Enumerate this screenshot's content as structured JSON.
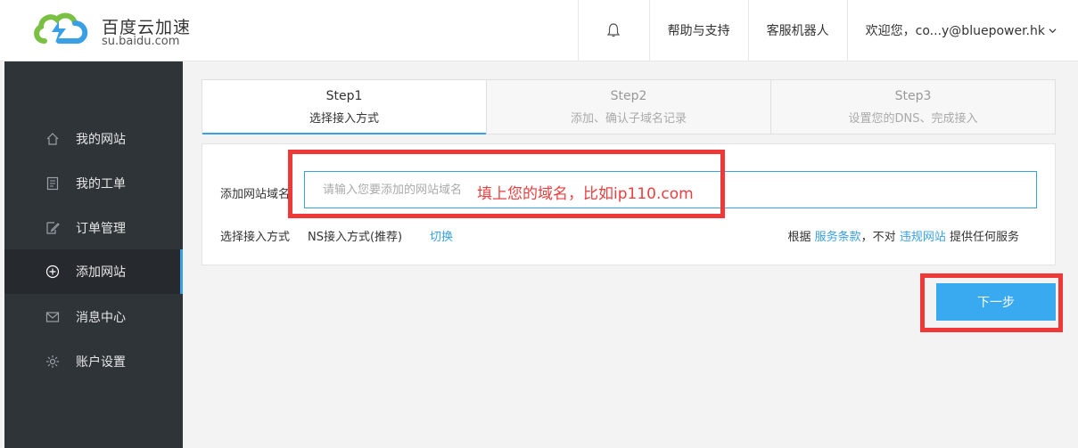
{
  "brand": {
    "title": "百度云加速",
    "subtitle": "su.baidu.com",
    "colors": {
      "green": "#7ac143",
      "blue": "#3aa0e6"
    }
  },
  "nav": {
    "bell_icon": "bell-icon",
    "help": "帮助与支持",
    "robot": "客服机器人",
    "user": "欢迎您，co...y@bluepower.hk"
  },
  "sidebar": {
    "items": [
      {
        "label": "我的网站",
        "icon": "home-icon"
      },
      {
        "label": "我的工单",
        "icon": "document-icon"
      },
      {
        "label": "订单管理",
        "icon": "edit-icon"
      },
      {
        "label": "添加网站",
        "icon": "plus-circle-icon",
        "active": true
      },
      {
        "label": "消息中心",
        "icon": "mail-icon"
      },
      {
        "label": "账户设置",
        "icon": "gear-icon"
      }
    ]
  },
  "steps": [
    {
      "title": "Step1",
      "desc": "选择接入方式",
      "active": true
    },
    {
      "title": "Step2",
      "desc": "添加、确认子域名记录"
    },
    {
      "title": "Step3",
      "desc": "设置您的DNS、完成接入"
    }
  ],
  "form": {
    "domain_label": "添加网站域名",
    "domain_placeholder": "请输入您要添加的网站域名",
    "hint": "填上您的域名，比如ip110.com",
    "method_label": "选择接入方式",
    "method_value": "NS接入方式(推荐)",
    "switch": "切换",
    "terms_prefix": "根据",
    "terms_link1": "服务条款",
    "terms_mid": "，不对",
    "terms_link2": "违规网站",
    "terms_suffix": "提供任何服务"
  },
  "next_button": "下一步",
  "annotation_color": "#f03838"
}
